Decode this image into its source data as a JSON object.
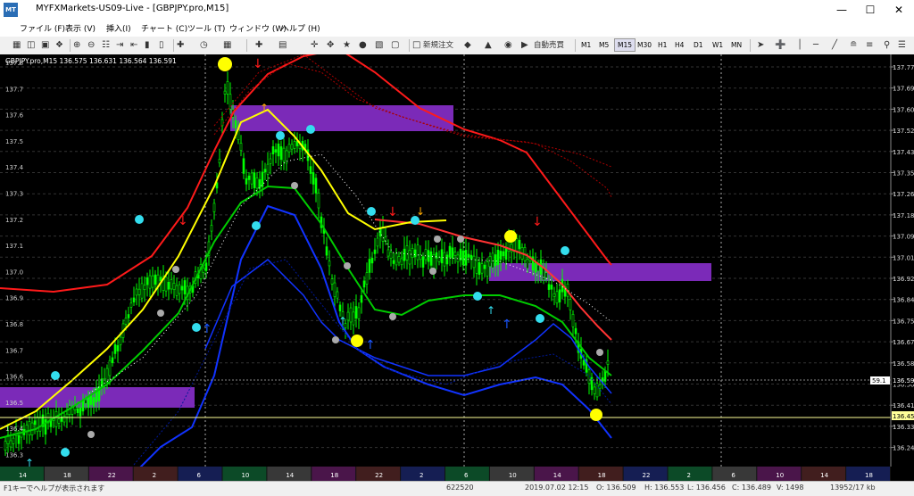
{
  "window": {
    "app_icon": "MT",
    "title": "MYFXMarkets-US09-Live - [GBPJPY.pro,M15]"
  },
  "menu": [
    "ファイル (F)",
    "表示 (V)",
    "挿入(I)",
    "チャート (C)",
    "ツール (T)",
    "ウィンドウ (W)",
    "ヘルプ (H)"
  ],
  "toolbar": {
    "new_order": "新規注文",
    "auto_trade": "自動売買",
    "timeframes": [
      "M1",
      "M5",
      "M15",
      "M30",
      "H1",
      "H4",
      "D1",
      "W1",
      "MN"
    ],
    "active_timeframe": "M15"
  },
  "chart": {
    "header": "GBPJPY.pro,M15  136.575 136.631 136.564 136.591",
    "price_labels_left": [
      "137.8",
      "137.7",
      "137.6",
      "137.5",
      "137.4",
      "137.3",
      "137.2",
      "137.1",
      "137.0",
      "136.9",
      "136.8",
      "136.7",
      "136.6",
      "136.5",
      "136.4",
      "136.3"
    ],
    "price_labels_right": [
      "137.776",
      "137.691",
      "137.606",
      "137.521",
      "137.436",
      "137.351",
      "137.266",
      "137.181",
      "137.096",
      "137.011",
      "136.926",
      "136.841",
      "136.756",
      "136.671",
      "136.586",
      "136.501",
      "136.416",
      "136.331",
      "136.246"
    ],
    "current_price": "136.591",
    "bid_tag": "59.1",
    "bid_price": "136.452",
    "time_labels": [
      "14",
      "18",
      "22",
      "2",
      "6",
      "10",
      "14",
      "18",
      "22",
      "2",
      "6",
      "10",
      "14",
      "18",
      "22",
      "2",
      "6",
      "10",
      "14",
      "18"
    ]
  },
  "status": {
    "help": "F1キーでヘルプが表示されます",
    "bars": "622520",
    "datetime": "2019.07.02 12:15",
    "open": "O: 136.509",
    "high": "H: 136.553",
    "low": "L: 136.456",
    "close": "C: 136.489",
    "volume": "V: 1498",
    "traffic": "13952/17 kb"
  },
  "colors": {
    "background": "#000000",
    "candle": "#00ff00",
    "upper_band": "#ff0000",
    "lower_band": "#0033ff",
    "middle_line": "#00cc00",
    "yellow_ma": "#ffff00",
    "zone": "#7b2ab8"
  }
}
